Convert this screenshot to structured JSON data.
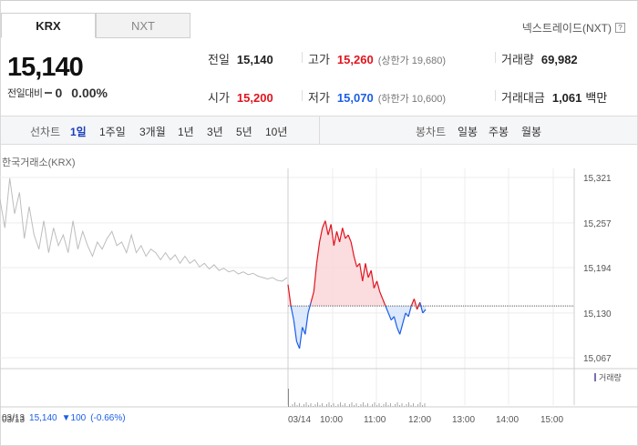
{
  "tabs": [
    {
      "label": "KRX",
      "active": true
    },
    {
      "label": "NXT",
      "active": false
    }
  ],
  "nxt_link": {
    "label": "넥스트레이드(NXT)",
    "help": "?"
  },
  "quote": {
    "price": "15,140",
    "change_label": "전일대비",
    "change_value": "0",
    "change_pct": "0.00%"
  },
  "stats": {
    "prev": {
      "label": "전일",
      "value": "15,140"
    },
    "open": {
      "label": "시가",
      "value": "15,200"
    },
    "high": {
      "label": "고가",
      "value": "15,260",
      "sub": "(상한가 19,680)"
    },
    "low": {
      "label": "저가",
      "value": "15,070",
      "sub": "(하한가 10,600)"
    },
    "volume": {
      "label": "거래량",
      "value": "69,982"
    },
    "amount": {
      "label": "거래대금",
      "value": "1,061",
      "unit": "백만"
    }
  },
  "period_bar": {
    "line_label": "선차트",
    "line_items": [
      "1일",
      "1주일",
      "3개월",
      "1년",
      "3년",
      "5년",
      "10년"
    ],
    "selected": "1일",
    "candle_label": "봉차트",
    "candle_items": [
      "일봉",
      "주봉",
      "월봉"
    ]
  },
  "chart_caption": "한국거래소(KRX)",
  "volume_legend": "거래량",
  "bottom_info": {
    "date": "03/13",
    "price": "15,140",
    "change": "▼100",
    "pct": "(-0.66%)"
  },
  "colors": {
    "up": "#e0141e",
    "down": "#1a5ee6",
    "prev_day_line": "#bdbdbd",
    "fill_up": "#fbd5d7",
    "fill_down": "#d4e3fb",
    "selected": "#1a3fb8"
  },
  "chart_data": {
    "type": "line",
    "y_ticks": [
      "15,321",
      "15,257",
      "15,194",
      "15,130",
      "15,067"
    ],
    "y_tick_values": [
      15321,
      15257,
      15194,
      15130,
      15067
    ],
    "ylim": [
      15067,
      15321
    ],
    "baseline": 15140,
    "x_ticks": [
      "03/14",
      "10:00",
      "11:00",
      "12:00",
      "13:00",
      "14:00",
      "15:00"
    ],
    "prev_day_label": "03/13",
    "prev_day_series": [
      15290,
      15250,
      15320,
      15270,
      15300,
      15235,
      15280,
      15240,
      15220,
      15260,
      15215,
      15250,
      15225,
      15240,
      15215,
      15260,
      15220,
      15245,
      15225,
      15210,
      15230,
      15220,
      15235,
      15245,
      15225,
      15230,
      15215,
      15240,
      15215,
      15225,
      15210,
      15220,
      15215,
      15205,
      15215,
      15205,
      15212,
      15200,
      15210,
      15200,
      15205,
      15195,
      15200,
      15192,
      15198,
      15190,
      15193,
      15188,
      15190,
      15185,
      15188,
      15184,
      15186,
      15182,
      15180,
      15178,
      15180,
      15176,
      15175,
      15180
    ],
    "today_series": [
      15170,
      15140,
      15120,
      15090,
      15080,
      15110,
      15100,
      15130,
      15145,
      15160,
      15200,
      15230,
      15250,
      15260,
      15240,
      15255,
      15225,
      15245,
      15230,
      15250,
      15235,
      15240,
      15230,
      15210,
      15195,
      15200,
      15175,
      15200,
      15180,
      15190,
      15165,
      15175,
      15160,
      15150,
      15140,
      15130,
      15120,
      15125,
      15110,
      15100,
      15115,
      15130,
      15125,
      15140,
      15150,
      15135,
      15145,
      15130,
      15135
    ]
  }
}
